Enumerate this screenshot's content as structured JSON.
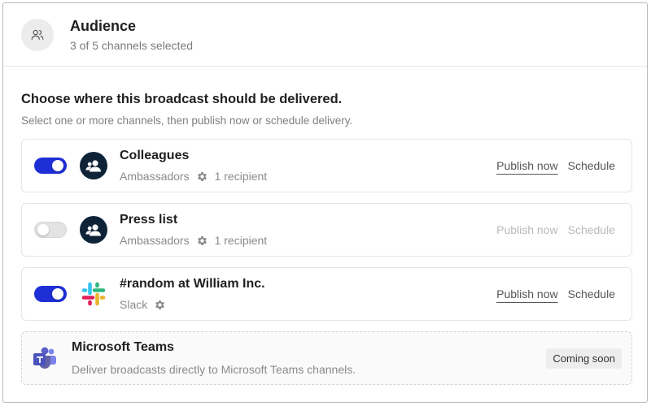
{
  "header": {
    "title": "Audience",
    "subtitle": "3 of 5 channels selected",
    "icon": "users-icon"
  },
  "intro": {
    "title": "Choose where this broadcast should be delivered.",
    "subtitle": "Select one or more channels, then publish now or schedule delivery."
  },
  "channels": [
    {
      "name": "Colleagues",
      "group": "Ambassadors",
      "recipients": "1 recipient",
      "enabled": true,
      "icon": "user-group-icon",
      "publish_label": "Publish now",
      "schedule_label": "Schedule"
    },
    {
      "name": "Press list",
      "group": "Ambassadors",
      "recipients": "1 recipient",
      "enabled": false,
      "icon": "user-group-icon",
      "publish_label": "Publish now",
      "schedule_label": "Schedule"
    },
    {
      "name": "#random at William Inc.",
      "group": "Slack",
      "enabled": true,
      "icon": "slack-icon",
      "publish_label": "Publish now",
      "schedule_label": "Schedule"
    }
  ],
  "teams": {
    "name": "Microsoft Teams",
    "description": "Deliver broadcasts directly to Microsoft Teams channels.",
    "badge": "Coming soon",
    "icon": "microsoft-teams-icon"
  },
  "colors": {
    "toggle_on": "#1f2fd6",
    "toggle_off": "#e3e3e3",
    "channel_icon_bg": "#0e2338",
    "teams_purple": "#5b5fc7"
  }
}
